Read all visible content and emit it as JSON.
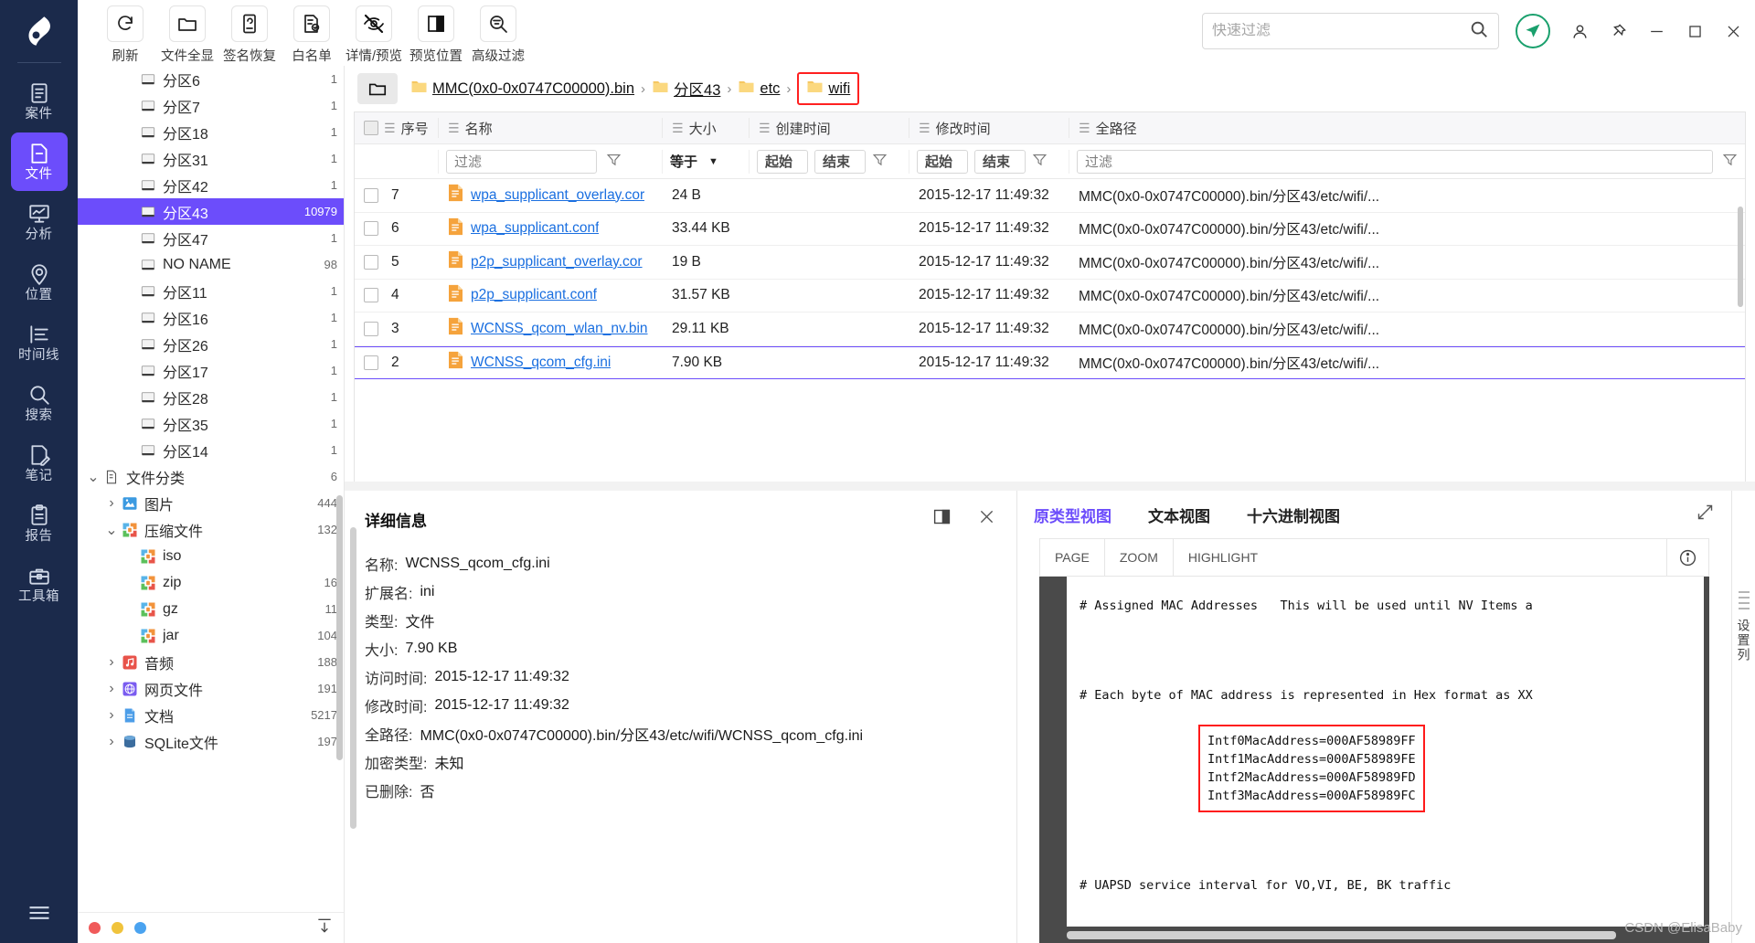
{
  "rail": {
    "logo": "app-logo",
    "items": [
      {
        "label": "案件",
        "icon": "case-icon",
        "active": false
      },
      {
        "label": "文件",
        "icon": "file-icon",
        "active": true
      },
      {
        "label": "分析",
        "icon": "analysis-icon",
        "active": false
      },
      {
        "label": "位置",
        "icon": "location-icon",
        "active": false
      },
      {
        "label": "时间线",
        "icon": "timeline-icon",
        "active": false
      },
      {
        "label": "搜索",
        "icon": "search-icon",
        "active": false
      },
      {
        "label": "笔记",
        "icon": "note-icon",
        "active": false
      },
      {
        "label": "报告",
        "icon": "report-icon",
        "active": false
      },
      {
        "label": "工具箱",
        "icon": "toolbox-icon",
        "active": false
      }
    ],
    "menu_icon": "hamburger-menu-icon"
  },
  "toolbar": {
    "buttons": [
      {
        "label": "刷新",
        "icon": "refresh-icon"
      },
      {
        "label": "文件全显",
        "icon": "folder-icon"
      },
      {
        "label": "签名恢复",
        "icon": "signature-recovery-icon"
      },
      {
        "label": "白名单",
        "icon": "whitelist-icon"
      },
      {
        "label": "详情/预览",
        "icon": "eye-off-icon"
      },
      {
        "label": "预览位置",
        "icon": "panel-layout-icon"
      },
      {
        "label": "高级过滤",
        "icon": "advanced-filter-icon"
      }
    ]
  },
  "search": {
    "placeholder": "快速过滤",
    "value": "",
    "icon": "search-icon"
  },
  "window": {
    "send_icon": "send-icon",
    "user_icon": "user-icon",
    "pin_icon": "pin-icon",
    "minimize_icon": "minimize-icon",
    "maximize_icon": "maximize-icon",
    "close_icon": "close-icon",
    "accent": "#6c4dfb",
    "green": "#1aa06d"
  },
  "tree": {
    "nodes": [
      {
        "label": "分区6",
        "count": "1",
        "icon": "disk-icon",
        "indent": 2,
        "caret": "",
        "selected": false
      },
      {
        "label": "分区7",
        "count": "1",
        "icon": "disk-icon",
        "indent": 2,
        "caret": "",
        "selected": false
      },
      {
        "label": "分区18",
        "count": "1",
        "icon": "disk-icon",
        "indent": 2,
        "caret": "",
        "selected": false
      },
      {
        "label": "分区31",
        "count": "1",
        "icon": "disk-icon",
        "indent": 2,
        "caret": "",
        "selected": false
      },
      {
        "label": "分区42",
        "count": "1",
        "icon": "disk-icon",
        "indent": 2,
        "caret": "",
        "selected": false
      },
      {
        "label": "分区43",
        "count": "10979",
        "icon": "disk-icon",
        "indent": 2,
        "caret": "",
        "selected": true
      },
      {
        "label": "分区47",
        "count": "1",
        "icon": "disk-icon",
        "indent": 2,
        "caret": "",
        "selected": false
      },
      {
        "label": "NO NAME",
        "count": "98",
        "icon": "disk-icon",
        "indent": 2,
        "caret": "",
        "selected": false
      },
      {
        "label": "分区11",
        "count": "1",
        "icon": "disk-icon",
        "indent": 2,
        "caret": "",
        "selected": false
      },
      {
        "label": "分区16",
        "count": "1",
        "icon": "disk-icon",
        "indent": 2,
        "caret": "",
        "selected": false
      },
      {
        "label": "分区26",
        "count": "1",
        "icon": "disk-icon",
        "indent": 2,
        "caret": "",
        "selected": false
      },
      {
        "label": "分区17",
        "count": "1",
        "icon": "disk-icon",
        "indent": 2,
        "caret": "",
        "selected": false
      },
      {
        "label": "分区28",
        "count": "1",
        "icon": "disk-icon",
        "indent": 2,
        "caret": "",
        "selected": false
      },
      {
        "label": "分区35",
        "count": "1",
        "icon": "disk-icon",
        "indent": 2,
        "caret": "",
        "selected": false
      },
      {
        "label": "分区14",
        "count": "1",
        "icon": "disk-icon",
        "indent": 2,
        "caret": "",
        "selected": false
      },
      {
        "label": "文件分类",
        "count": "6",
        "icon": "doc-category-icon",
        "indent": 0,
        "caret": "down",
        "selected": false
      },
      {
        "label": "图片",
        "count": "444",
        "icon": "image-icon",
        "indent": 1,
        "caret": "right",
        "selected": false
      },
      {
        "label": "压缩文件",
        "count": "132",
        "icon": "archive-icon",
        "indent": 1,
        "caret": "down",
        "selected": false
      },
      {
        "label": "iso",
        "count": "",
        "icon": "archive-icon",
        "indent": 2,
        "caret": "",
        "selected": false
      },
      {
        "label": "zip",
        "count": "16",
        "icon": "archive-icon",
        "indent": 2,
        "caret": "",
        "selected": false
      },
      {
        "label": "gz",
        "count": "11",
        "icon": "archive-icon",
        "indent": 2,
        "caret": "",
        "selected": false
      },
      {
        "label": "jar",
        "count": "104",
        "icon": "archive-icon",
        "indent": 2,
        "caret": "",
        "selected": false
      },
      {
        "label": "音频",
        "count": "188",
        "icon": "audio-icon",
        "indent": 1,
        "caret": "right",
        "selected": false
      },
      {
        "label": "网页文件",
        "count": "191",
        "icon": "web-icon",
        "indent": 1,
        "caret": "right",
        "selected": false
      },
      {
        "label": "文档",
        "count": "5217",
        "icon": "document-icon",
        "indent": 1,
        "caret": "right",
        "selected": false
      },
      {
        "label": "SQLite文件",
        "count": "197",
        "icon": "sqlite-icon",
        "indent": 1,
        "caret": "right",
        "selected": false
      }
    ],
    "status_dots": [
      "#f05a5a",
      "#f0c33c",
      "#4aa3f0"
    ],
    "export_icon": "export-icon"
  },
  "breadcrumb": {
    "home_icon": "folder-open-icon",
    "items": [
      {
        "label": "MMC(0x0-0x0747C00000).bin",
        "highlight": false
      },
      {
        "label": "分区43",
        "highlight": false
      },
      {
        "label": "etc",
        "highlight": false
      },
      {
        "label": "wifi",
        "highlight": true
      }
    ],
    "separator": "›",
    "highlight_color": "#ff2020"
  },
  "table": {
    "columns": [
      {
        "key": "idx",
        "label": "序号"
      },
      {
        "key": "name",
        "label": "名称"
      },
      {
        "key": "size",
        "label": "大小"
      },
      {
        "key": "ctime",
        "label": "创建时间"
      },
      {
        "key": "mtime",
        "label": "修改时间"
      },
      {
        "key": "path",
        "label": "全路径"
      }
    ],
    "filters": {
      "name_placeholder": "过滤",
      "size_operator": "等于",
      "ctime_start": "起始",
      "ctime_end": "结束",
      "mtime_start": "起始",
      "mtime_end": "结束",
      "path_placeholder": "过滤",
      "funnel_icon": "funnel-icon",
      "chevron_icon": "chevron-down-icon"
    },
    "rows": [
      {
        "idx": "2",
        "name": "WCNSS_qcom_cfg.ini",
        "size": "7.90 KB",
        "ctime": "",
        "mtime": "2015-12-17 11:49:32",
        "path": "MMC(0x0-0x0747C00000).bin/分区43/etc/wifi/...",
        "selected": true
      },
      {
        "idx": "3",
        "name": "WCNSS_qcom_wlan_nv.bin",
        "size": "29.11 KB",
        "ctime": "",
        "mtime": "2015-12-17 11:49:32",
        "path": "MMC(0x0-0x0747C00000).bin/分区43/etc/wifi/...",
        "selected": false
      },
      {
        "idx": "4",
        "name": "p2p_supplicant.conf",
        "size": "31.57 KB",
        "ctime": "",
        "mtime": "2015-12-17 11:49:32",
        "path": "MMC(0x0-0x0747C00000).bin/分区43/etc/wifi/...",
        "selected": false
      },
      {
        "idx": "5",
        "name": "p2p_supplicant_overlay.cor",
        "size": "19 B",
        "ctime": "",
        "mtime": "2015-12-17 11:49:32",
        "path": "MMC(0x0-0x0747C00000).bin/分区43/etc/wifi/...",
        "selected": false
      },
      {
        "idx": "6",
        "name": "wpa_supplicant.conf",
        "size": "33.44 KB",
        "ctime": "",
        "mtime": "2015-12-17 11:49:32",
        "path": "MMC(0x0-0x0747C00000).bin/分区43/etc/wifi/...",
        "selected": false
      },
      {
        "idx": "7",
        "name": "wpa_supplicant_overlay.cor",
        "size": "24 B",
        "ctime": "",
        "mtime": "2015-12-17 11:49:32",
        "path": "MMC(0x0-0x0747C00000).bin/分区43/etc/wifi/...",
        "selected": false
      }
    ]
  },
  "details": {
    "title": "详细信息",
    "panel_icon": "panel-layout-icon",
    "close_icon": "close-icon",
    "fields": [
      {
        "key": "名称:",
        "value": "WCNSS_qcom_cfg.ini"
      },
      {
        "key": "扩展名:",
        "value": "ini"
      },
      {
        "key": "类型:",
        "value": "文件"
      },
      {
        "key": "大小:",
        "value": "7.90 KB"
      },
      {
        "key": "访问时间:",
        "value": "2015-12-17 11:49:32"
      },
      {
        "key": "修改时间:",
        "value": "2015-12-17 11:49:32"
      },
      {
        "key": "全路径:",
        "value": "MMC(0x0-0x0747C00000).bin/分区43/etc/wifi/WCNSS_qcom_cfg.ini"
      },
      {
        "key": "加密类型:",
        "value": "未知"
      },
      {
        "key": "已删除:",
        "value": "否"
      }
    ]
  },
  "preview": {
    "tabs": [
      {
        "label": "原类型视图",
        "active": true
      },
      {
        "label": "文本视图",
        "active": false
      },
      {
        "label": "十六进制视图",
        "active": false
      }
    ],
    "expand_icon": "expand-icon",
    "buttons": [
      "PAGE",
      "ZOOM",
      "HIGHLIGHT"
    ],
    "info_icon": "info-icon",
    "content": {
      "line_top": "# Assigned MAC Addresses   This will be used until NV Items a",
      "line_second": "# Each byte of MAC address is represented in Hex format as XX",
      "highlighted_lines": [
        "Intf0MacAddress=000AF58989FF",
        "Intf1MacAddress=000AF58989FE",
        "Intf2MacAddress=000AF58989FD",
        "Intf3MacAddress=000AF58989FC"
      ],
      "line_bottom": "# UAPSD service interval for VO,VI, BE, BK traffic",
      "highlight_color": "#ff1a1a"
    }
  },
  "right_rail": {
    "label": "设置列",
    "grip_icon": "grip-icon"
  },
  "watermark": "CSDN @ElisaBaby"
}
